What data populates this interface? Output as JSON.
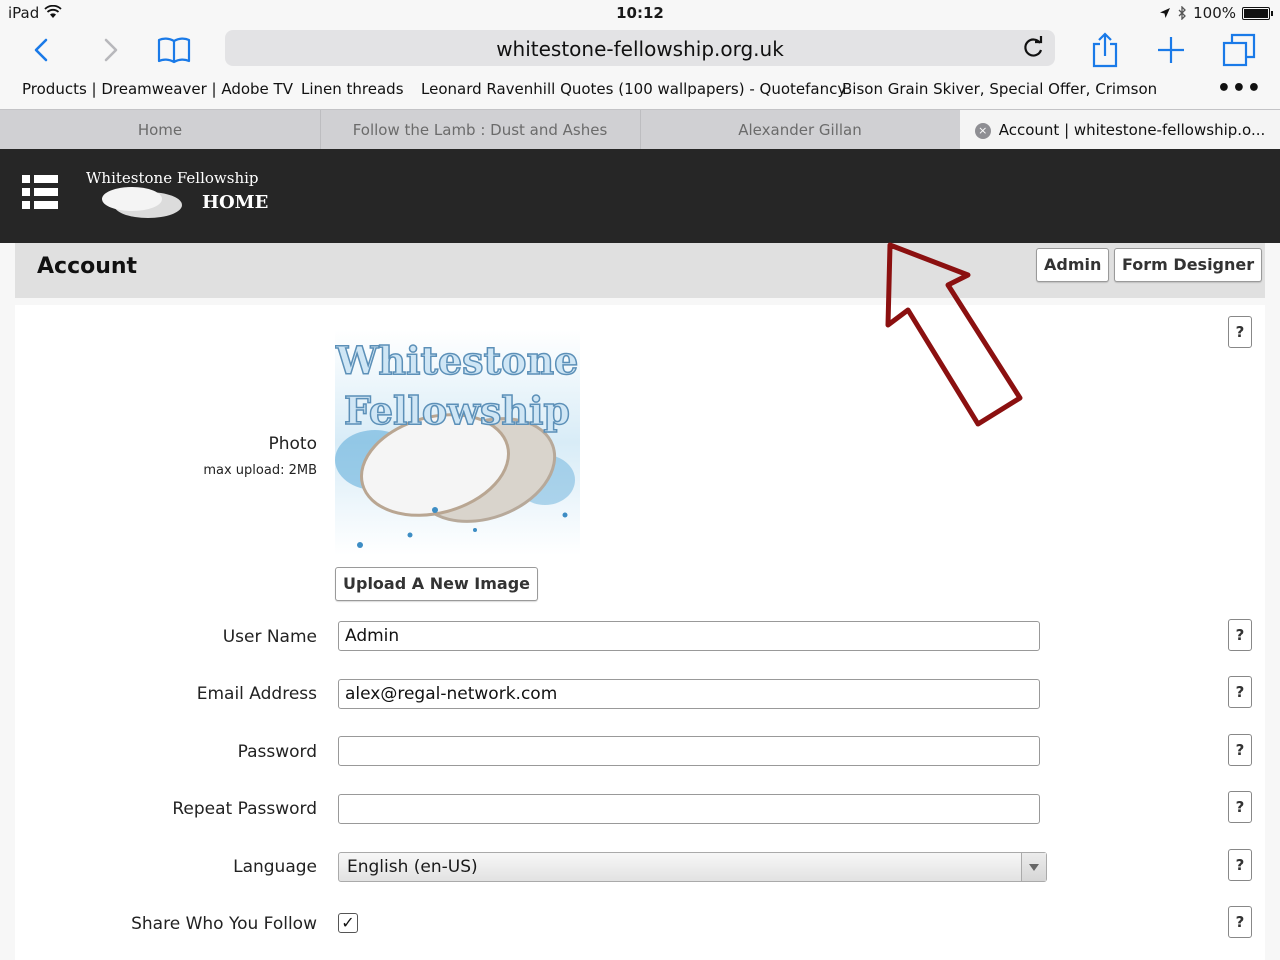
{
  "status_bar": {
    "device": "iPad",
    "time": "10:12",
    "battery": "100%"
  },
  "browser": {
    "url": "whitestone-fellowship.org.uk",
    "bookmarks": [
      "Products | Dreamweaver | Adobe TV",
      "Linen threads",
      "Leonard Ravenhill Quotes (100 wallpapers) - Quotefancy",
      "Bison Grain Skiver, Special Offer, Crimson"
    ],
    "more": "•••",
    "tabs": [
      {
        "label": "Home",
        "active": false
      },
      {
        "label": "Follow the Lamb : Dust and Ashes",
        "active": false
      },
      {
        "label": "Alexander Gillan",
        "active": false
      },
      {
        "label": "Account | whitestone-fellowship.o...",
        "active": true
      }
    ],
    "tab_close": "×"
  },
  "site": {
    "logo_text": "Whitestone Fellowship",
    "logo_home": "HOME"
  },
  "page": {
    "title": "Account",
    "admin_button": "Admin",
    "form_designer_button": "Form Designer",
    "help": "?"
  },
  "form": {
    "photo_label": "Photo",
    "photo_note": "max upload: 2MB",
    "photo_line1": "Whitestone",
    "photo_line2": "Fellowship",
    "upload_button": "Upload A New Image",
    "username_label": "User Name",
    "username_value": "Admin",
    "email_label": "Email Address",
    "email_value": "alex@regal-network.com",
    "password_label": "Password",
    "password_value": "",
    "repeat_password_label": "Repeat Password",
    "repeat_password_value": "",
    "language_label": "Language",
    "language_value": "English (en-US)",
    "share_label": "Share Who You Follow",
    "share_checked": true,
    "check_mark": "✓"
  },
  "colors": {
    "ios_blue": "#1a7ae8",
    "site_header": "#262626",
    "annotation_arrow": "#8b1010"
  },
  "icons": [
    "back-icon",
    "forward-icon",
    "bookmarks-icon",
    "reload-icon",
    "share-icon",
    "new-tab-icon",
    "tabs-icon",
    "menu-icon",
    "wifi-icon",
    "location-icon",
    "bluetooth-icon",
    "battery-icon"
  ]
}
